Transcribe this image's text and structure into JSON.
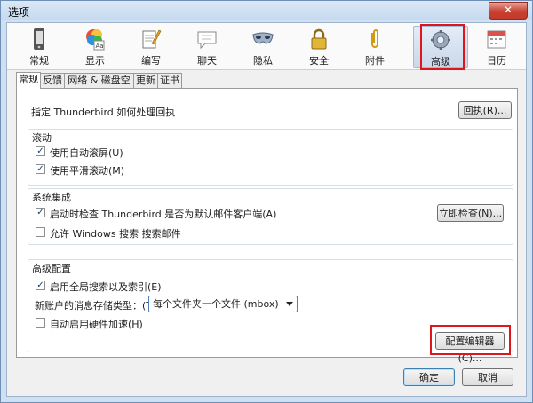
{
  "window": {
    "title": "选项",
    "close_label": "✕"
  },
  "toolbar": {
    "panes": [
      {
        "label": "常规",
        "icon": "phone-icon"
      },
      {
        "label": "显示",
        "icon": "palette-icon"
      },
      {
        "label": "编写",
        "icon": "compose-icon"
      },
      {
        "label": "聊天",
        "icon": "chat-bubble-icon"
      },
      {
        "label": "隐私",
        "icon": "mask-icon"
      },
      {
        "label": "安全",
        "icon": "padlock-icon"
      },
      {
        "label": "附件",
        "icon": "paperclip-icon"
      },
      {
        "label": "高级",
        "icon": "gear-icon",
        "selected": true
      },
      {
        "label": "日历",
        "icon": "calendar-icon"
      }
    ]
  },
  "tabs": [
    "常规",
    "反馈",
    "网络 & 磁盘空间",
    "更新",
    "证书"
  ],
  "general": {
    "receipt_label": "指定 Thunderbird 如何处理回执",
    "receipt_button": "回执(R)..."
  },
  "scrolling": {
    "title": "滚动",
    "autoscroll": {
      "label": "使用自动滚屏(U)",
      "checked": true
    },
    "smooth": {
      "label": "使用平滑滚动(M)",
      "checked": true
    }
  },
  "system": {
    "title": "系统集成",
    "check_default": {
      "label": "启动时检查 Thunderbird 是否为默认邮件客户端(A)",
      "checked": true
    },
    "check_now_button": "立即检查(N)...",
    "windows_search": {
      "label": "允许 Windows 搜索 搜索邮件",
      "checked": false
    }
  },
  "advanced": {
    "title": "高级配置",
    "global_search": {
      "label": "启用全局搜索以及索引(E)",
      "checked": true
    },
    "storage_label": "新账户的消息存储类型：(T)",
    "storage_value": "每个文件夹一个文件 (mbox)",
    "hw_accel": {
      "label": "自动启用硬件加速(H)",
      "checked": false
    },
    "config_editor_button": "配置编辑器(C)..."
  },
  "footer": {
    "ok": "确定",
    "cancel": "取消"
  },
  "colors": {
    "highlight": "#e0141b",
    "window_frame": "#cfe0f1"
  }
}
